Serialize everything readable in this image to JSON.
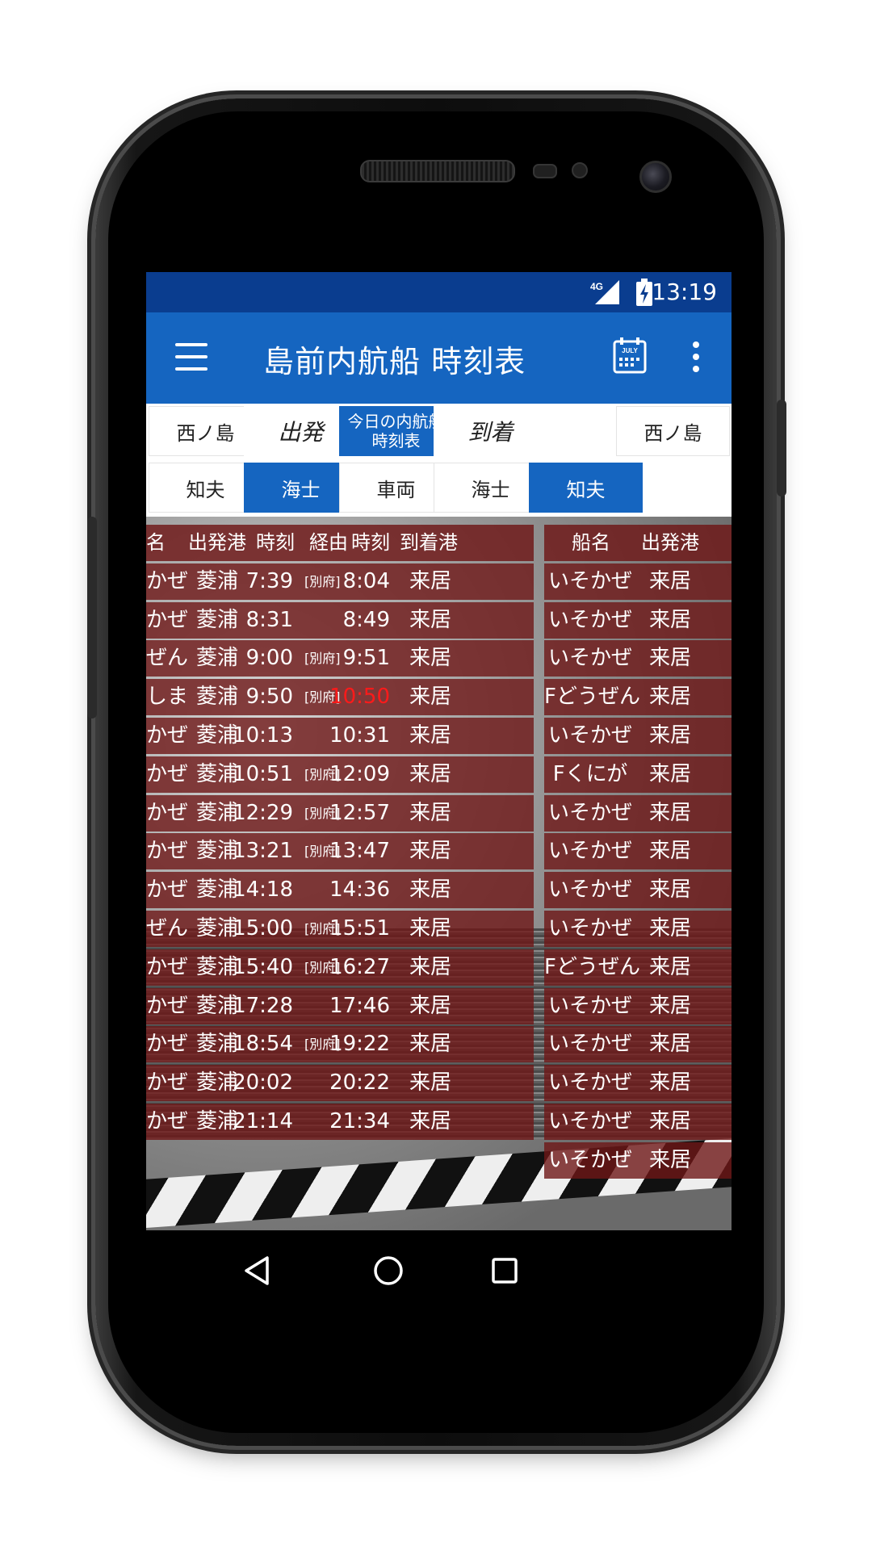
{
  "status_bar": {
    "network": "4G",
    "time": "13:19"
  },
  "app_bar": {
    "title": "島前内航船 時刻表",
    "calendar_icon_text": "JULY"
  },
  "selector": {
    "row1": {
      "departure_port": "西ノ島",
      "departure_label": "出発",
      "today_button": "今日の内航船時刻表",
      "arrival_label": "到着",
      "arrival_port": "西ノ島"
    },
    "row2": [
      {
        "label": "知夫",
        "active": false
      },
      {
        "label": "海士",
        "active": true
      },
      {
        "label": "車両",
        "active": false
      },
      {
        "label": "海士",
        "active": false
      },
      {
        "label": "知夫",
        "active": true
      }
    ]
  },
  "left_table": {
    "headers": [
      "名",
      "出発港",
      "時刻",
      "経由",
      "時刻",
      "到着港"
    ],
    "rows": [
      {
        "ship": "かぜ",
        "from": "菱浦",
        "dep": "7:39",
        "via": "[別府]",
        "arr": "8:04",
        "to": "来居",
        "arr_highlight": false
      },
      {
        "ship": "かぜ",
        "from": "菱浦",
        "dep": "8:31",
        "via": "",
        "arr": "8:49",
        "to": "来居",
        "arr_highlight": false
      },
      {
        "ship": "ぜん",
        "from": "菱浦",
        "dep": "9:00",
        "via": "[別府]",
        "arr": "9:51",
        "to": "来居",
        "arr_highlight": false
      },
      {
        "ship": "しま",
        "from": "菱浦",
        "dep": "9:50",
        "via": "[別府]",
        "arr": "10:50",
        "to": "来居",
        "arr_highlight": true
      },
      {
        "ship": "かぜ",
        "from": "菱浦",
        "dep": "10:13",
        "via": "",
        "arr": "10:31",
        "to": "来居",
        "arr_highlight": false
      },
      {
        "ship": "かぜ",
        "from": "菱浦",
        "dep": "10:51",
        "via": "[別府]",
        "arr": "12:09",
        "to": "来居",
        "arr_highlight": false
      },
      {
        "ship": "かぜ",
        "from": "菱浦",
        "dep": "12:29",
        "via": "[別府]",
        "arr": "12:57",
        "to": "来居",
        "arr_highlight": false
      },
      {
        "ship": "かぜ",
        "from": "菱浦",
        "dep": "13:21",
        "via": "[別府]",
        "arr": "13:47",
        "to": "来居",
        "arr_highlight": false
      },
      {
        "ship": "かぜ",
        "from": "菱浦",
        "dep": "14:18",
        "via": "",
        "arr": "14:36",
        "to": "来居",
        "arr_highlight": false
      },
      {
        "ship": "ぜん",
        "from": "菱浦",
        "dep": "15:00",
        "via": "[別府]",
        "arr": "15:51",
        "to": "来居",
        "arr_highlight": false
      },
      {
        "ship": "かぜ",
        "from": "菱浦",
        "dep": "15:40",
        "via": "[別府]",
        "arr": "16:27",
        "to": "来居",
        "arr_highlight": false
      },
      {
        "ship": "かぜ",
        "from": "菱浦",
        "dep": "17:28",
        "via": "",
        "arr": "17:46",
        "to": "来居",
        "arr_highlight": false
      },
      {
        "ship": "かぜ",
        "from": "菱浦",
        "dep": "18:54",
        "via": "[別府]",
        "arr": "19:22",
        "to": "来居",
        "arr_highlight": false
      },
      {
        "ship": "かぜ",
        "from": "菱浦",
        "dep": "20:02",
        "via": "",
        "arr": "20:22",
        "to": "来居",
        "arr_highlight": false
      },
      {
        "ship": "かぜ",
        "from": "菱浦",
        "dep": "21:14",
        "via": "",
        "arr": "21:34",
        "to": "来居",
        "arr_highlight": false
      }
    ]
  },
  "right_table": {
    "headers": [
      "船名",
      "出発港"
    ],
    "rows": [
      {
        "ship": "いそかぜ",
        "from": "来居"
      },
      {
        "ship": "いそかぜ",
        "from": "来居"
      },
      {
        "ship": "いそかぜ",
        "from": "来居"
      },
      {
        "ship": "Fどうぜん",
        "from": "来居"
      },
      {
        "ship": "いそかぜ",
        "from": "来居"
      },
      {
        "ship": "Fくにが",
        "from": "来居"
      },
      {
        "ship": "いそかぜ",
        "from": "来居"
      },
      {
        "ship": "いそかぜ",
        "from": "来居"
      },
      {
        "ship": "いそかぜ",
        "from": "来居"
      },
      {
        "ship": "いそかぜ",
        "from": "来居"
      },
      {
        "ship": "Fどうぜん",
        "from": "来居"
      },
      {
        "ship": "いそかぜ",
        "from": "来居"
      },
      {
        "ship": "いそかぜ",
        "from": "来居"
      },
      {
        "ship": "いそかぜ",
        "from": "来居"
      },
      {
        "ship": "いそかぜ",
        "from": "来居"
      },
      {
        "ship": "いそかぜ",
        "from": "来居"
      }
    ]
  },
  "colors": {
    "status_bar": "#0a3d8f",
    "app_bar": "#1565c0",
    "active_tab": "#1565c0",
    "row_bg": "#6e1616",
    "highlight_time": "#ff1a1a"
  },
  "icons": {
    "menu": "hamburger-icon",
    "calendar": "calendar-icon",
    "more": "more-vert-icon",
    "back": "back-triangle-icon",
    "home": "home-circle-icon",
    "recents": "recents-square-icon"
  }
}
